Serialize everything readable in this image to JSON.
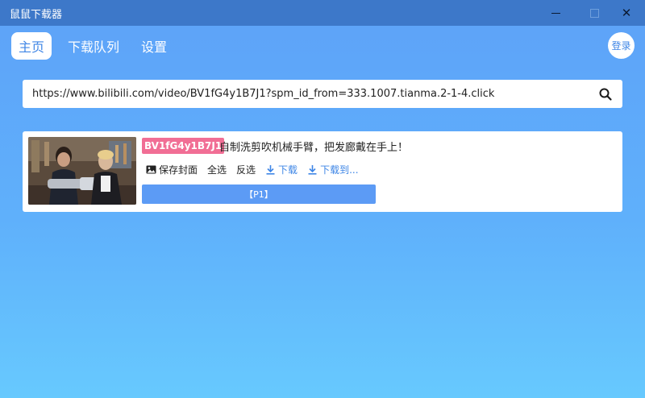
{
  "window": {
    "title": "鼠鼠下载器",
    "controls": {
      "minimize": "",
      "maximize": "",
      "close": "✕"
    }
  },
  "nav": {
    "tabs": [
      {
        "label": "主页",
        "active": true
      },
      {
        "label": "下载队列",
        "active": false
      },
      {
        "label": "设置",
        "active": false
      }
    ],
    "login_label": "登录"
  },
  "search": {
    "value": "https://www.bilibili.com/video/BV1fG4y1B7J1?spm_id_from=333.1007.tianma.2-1-4.click",
    "icon": "search-icon"
  },
  "result": {
    "bvid": "BV1fG4y1B7J1",
    "title": "自制洗剪吹机械手臂，把发廊戴在手上！",
    "thumbnail_icon": "video-thumbnail",
    "actions": {
      "save_cover": "保存封面",
      "select_all": "全选",
      "invert_selection": "反选",
      "download": "下载",
      "download_to": "下载到..."
    },
    "part_label": "【P1】"
  },
  "colors": {
    "titlebar": "#3d78c9",
    "accent": "#3f86e6",
    "bvid_badge": "#f16e95",
    "part_button": "#5c9bf5"
  }
}
